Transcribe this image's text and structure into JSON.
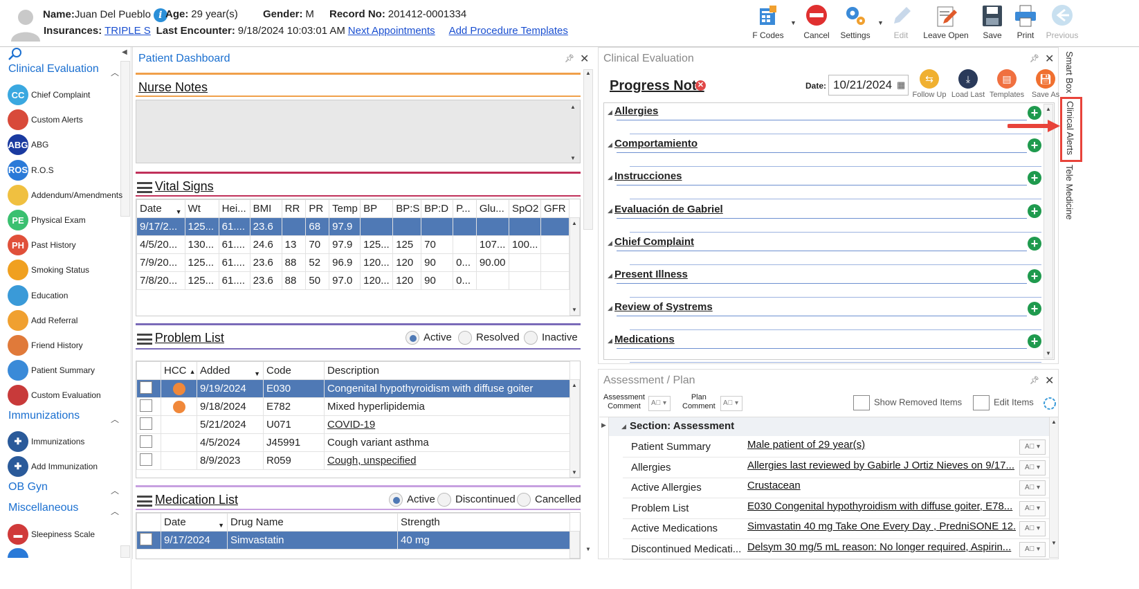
{
  "header": {
    "name_label": "Name:",
    "name": "Juan Del Pueblo",
    "age_label": "Age:",
    "age": "29 year(s)",
    "gender_label": "Gender:",
    "gender": "M",
    "record_label": "Record No:",
    "record": "201412-0001334",
    "ins_label": "Insurances:",
    "insurance": "TRIPLE S",
    "last_enc_label": "Last Encounter:",
    "last_encounter": "9/18/2024 10:03:01 AM",
    "next_appt": "Next Appointments",
    "add_proc": "Add Procedure Templates"
  },
  "toolbar": {
    "fcodes": "F Codes",
    "cancel": "Cancel",
    "settings": "Settings",
    "edit": "Edit",
    "leave_open": "Leave Open",
    "save": "Save",
    "print": "Print",
    "previous": "Previous"
  },
  "nav": {
    "sec_clinical": "Clinical Evaluation",
    "items_clinical": [
      {
        "label": "Chief Complaint",
        "abbr": "CC"
      },
      {
        "label": "Custom Alerts",
        "abbr": ""
      },
      {
        "label": "ABG",
        "abbr": "ABG"
      },
      {
        "label": "R.O.S",
        "abbr": "ROS"
      },
      {
        "label": "Addendum/Amendments",
        "abbr": ""
      },
      {
        "label": "Physical Exam",
        "abbr": "PE"
      },
      {
        "label": "Past History",
        "abbr": "PH"
      },
      {
        "label": "Smoking Status",
        "abbr": ""
      },
      {
        "label": "Education",
        "abbr": ""
      },
      {
        "label": "Add Referral",
        "abbr": ""
      },
      {
        "label": "Friend History",
        "abbr": ""
      },
      {
        "label": "Patient Summary",
        "abbr": ""
      },
      {
        "label": "Custom Evaluation",
        "abbr": ""
      }
    ],
    "sec_immun": "Immunizations",
    "items_immun": [
      {
        "label": "Immunizations"
      },
      {
        "label": "Add Immunization"
      }
    ],
    "sec_obgyn": "OB Gyn",
    "sec_misc": "Miscellaneous",
    "items_misc": [
      {
        "label": "Sleepiness Scale"
      }
    ]
  },
  "dashboard": {
    "title": "Patient Dashboard",
    "nurse_notes": "Nurse Notes",
    "vital_signs": "Vital Signs",
    "vitals_cols": [
      "Date",
      "Wt",
      "Hei...",
      "BMI",
      "RR",
      "PR",
      "Temp",
      "BP",
      "BP:S",
      "BP:D",
      "P...",
      "Glu...",
      "SpO2",
      "GFR"
    ],
    "vitals_rows": [
      [
        "9/17/2...",
        "125...",
        "61....",
        "23.6",
        "",
        "68",
        "97.9",
        "",
        "",
        "",
        "",
        "",
        "",
        ""
      ],
      [
        "4/5/20...",
        "130...",
        "61....",
        "24.6",
        "13",
        "70",
        "97.9",
        "125...",
        "125",
        "70",
        "",
        "107...",
        "100...",
        ""
      ],
      [
        "7/9/20...",
        "125...",
        "61....",
        "23.6",
        "88",
        "52",
        "96.9",
        "120...",
        "120",
        "90",
        "0...",
        "90.00",
        "",
        ""
      ],
      [
        "7/8/20...",
        "125...",
        "61....",
        "23.6",
        "88",
        "50",
        "97.0",
        "120...",
        "120",
        "90",
        "0...",
        "",
        "",
        ""
      ]
    ],
    "problem_list": "Problem List",
    "pl_filters": [
      "Active",
      "Resolved",
      "Inactive"
    ],
    "pl_cols": [
      "",
      "HCC",
      "Added",
      "Code",
      "Description"
    ],
    "pl_rows": [
      {
        "hcc": true,
        "added": "9/19/2024",
        "code": "E030",
        "desc": "Congenital hypothyroidism with diffuse goiter",
        "link": false
      },
      {
        "hcc": true,
        "added": "9/18/2024",
        "code": "E782",
        "desc": "Mixed hyperlipidemia",
        "link": false
      },
      {
        "hcc": false,
        "added": "5/21/2024",
        "code": "U071",
        "desc": "COVID-19",
        "link": true
      },
      {
        "hcc": false,
        "added": "4/5/2024",
        "code": "J45991",
        "desc": "Cough variant asthma",
        "link": false
      },
      {
        "hcc": false,
        "added": "8/9/2023",
        "code": "R059",
        "desc": "Cough, unspecified",
        "link": true
      }
    ],
    "medication_list": "Medication List",
    "ml_filters": [
      "Active",
      "Discontinued",
      "Cancelled"
    ],
    "ml_cols": [
      "",
      "Date",
      "Drug Name",
      "Strength"
    ],
    "ml_rows": [
      {
        "date": "9/17/2024",
        "drug": "Simvastatin",
        "strength": "40 mg"
      }
    ]
  },
  "clinical": {
    "title": "Clinical Evaluation",
    "progress_note": "Progress Note",
    "date_label": "Date:",
    "date": "10/21/2024",
    "actions": [
      "Follow Up",
      "Load Last",
      "Templates",
      "Save As"
    ],
    "sections": [
      "Allergies",
      "Comportamiento",
      "Instrucciones",
      "Evaluación de Gabriel",
      "Chief Complaint",
      "Present Illness",
      "Review of Systrems",
      "Medications"
    ]
  },
  "assessment": {
    "title": "Assessment / Plan",
    "assess_comment": "Assessment\nComment",
    "plan_comment": "Plan\nComment",
    "show_removed": "Show Removed Items",
    "edit_items": "Edit Items",
    "section": "Section: Assessment",
    "rows": [
      {
        "label": "Patient Summary",
        "value": "Male patient of 29 year(s)"
      },
      {
        "label": "Allergies",
        "value": "Allergies last reviewed by Gabirle J Ortiz Nieves on 9/17..."
      },
      {
        "label": "Active Allergies",
        "value": "Crustacean"
      },
      {
        "label": "Problem List",
        "value": "E030 Congenital hypothyroidism with diffuse goiter, E78..."
      },
      {
        "label": "Active Medications",
        "value": "Simvastatin 40 mg Take One Every Day , PredniSONE 12..."
      },
      {
        "label": "Discontinued Medicati...",
        "value": "Delsym 30 mg/5 mL reason: No longer required, Aspirin..."
      }
    ]
  },
  "side_tabs": [
    "Smart Box",
    "Clinical Alerts",
    "Tele Medicine"
  ],
  "colors": {
    "accent": "#1a6fd0",
    "selected_row": "#4f79b5",
    "highlight_box": "#e8433a"
  }
}
